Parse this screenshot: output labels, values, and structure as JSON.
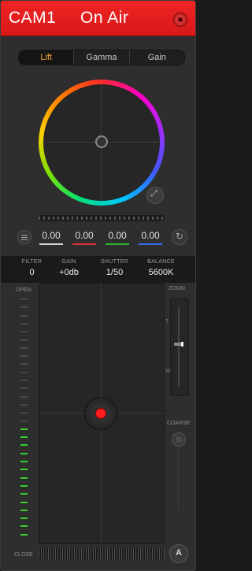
{
  "header": {
    "camera": "CAM1",
    "status": "On Air",
    "status_color": "#e81c1c"
  },
  "tabs": [
    {
      "label": "Lift",
      "active": true
    },
    {
      "label": "Gamma",
      "active": false
    },
    {
      "label": "Gain",
      "active": false
    }
  ],
  "color_values": [
    {
      "value": "0.00",
      "underline": "#d6d6d6"
    },
    {
      "value": "0.00",
      "underline": "#e03232"
    },
    {
      "value": "0.00",
      "underline": "#2fb52f"
    },
    {
      "value": "0.00",
      "underline": "#3a6cf0"
    }
  ],
  "settings": [
    {
      "label": "FILTER",
      "value": "0"
    },
    {
      "label": "GAIN",
      "value": "+0db"
    },
    {
      "label": "SHUTTER",
      "value": "1/50"
    },
    {
      "label": "BALANCE",
      "value": "5600K"
    }
  ],
  "iris": {
    "open_label": "OPEN",
    "close_label": "CLOSE",
    "lit_color": "#35d235",
    "unlit_color": "#4a4a4a",
    "level": 0.45
  },
  "zoom": {
    "title": "ZOOM",
    "tele": "T",
    "wide": "W"
  },
  "coarse": {
    "title": "COARSE"
  },
  "icons": {
    "menu": "menu-icon",
    "reset": "reset-icon",
    "auto_focus": "auto-focus-icon",
    "wheel_reset": "wheel-reset-icon"
  }
}
